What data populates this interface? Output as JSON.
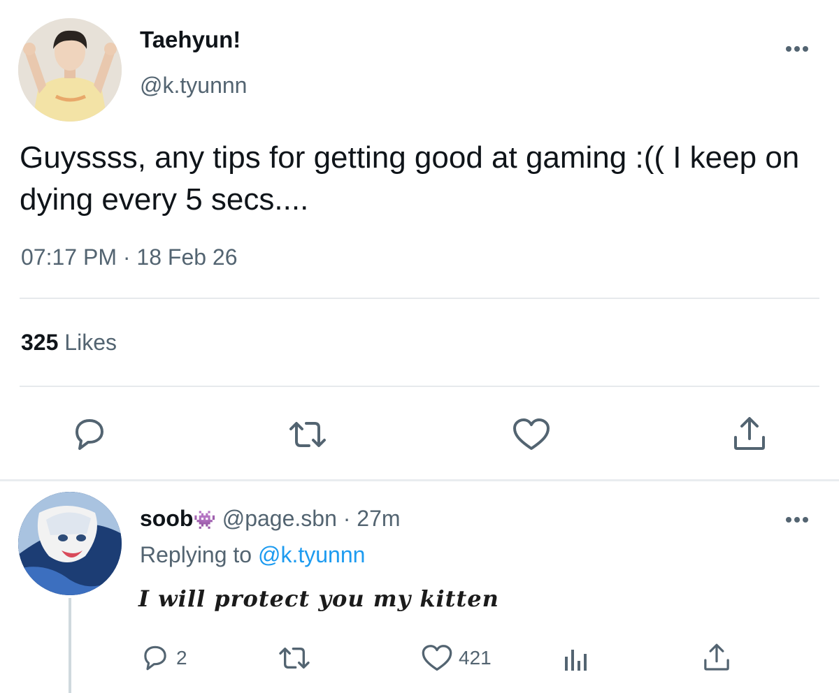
{
  "tweet": {
    "display_name": "Taehyun!",
    "handle": "@k.tyunnn",
    "text": "Guyssss, any tips for getting good at gaming :(( I keep on dying every 5 secs....",
    "timestamp": "07:17 PM · 18 Feb 26",
    "likes_count": "325",
    "likes_label": "Likes",
    "actions": [
      "reply-icon",
      "retweet-icon",
      "heart-icon",
      "share-icon"
    ],
    "menu_icon": "more-icon"
  },
  "reply": {
    "display_name": "soob",
    "emoji": "👾",
    "handle": "@page.sbn",
    "separator": "·",
    "time": "27m",
    "replying_to_label": "Replying to",
    "replying_to_handle": "@k.tyunnn",
    "text": "I will protect you my kitten",
    "reply_count": "2",
    "like_count": "421",
    "actions": [
      "reply-icon",
      "retweet-icon",
      "heart-icon",
      "analytics-icon",
      "share-icon"
    ]
  },
  "colors": {
    "text_primary": "#0f1419",
    "text_secondary": "#536471",
    "link": "#1d9bf0",
    "divider": "#e6e9ec",
    "emoji_purple": "#8e5ac8"
  }
}
